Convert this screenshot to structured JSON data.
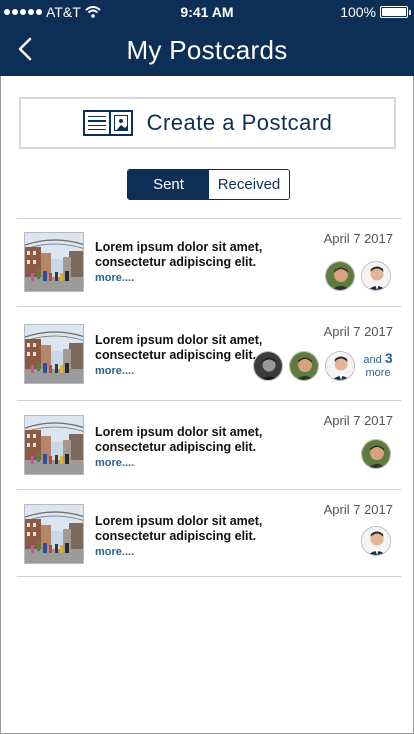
{
  "status_bar": {
    "carrier": "AT&T",
    "time": "9:41 AM",
    "battery": "100%"
  },
  "header": {
    "title": "My Postcards"
  },
  "create_button": {
    "label": "Create a Postcard"
  },
  "segmented": {
    "sent_label": "Sent",
    "received_label": "Received",
    "selected": "Sent"
  },
  "postcards": [
    {
      "text": "Lorem ipsum dolor sit amet, consectetur adipiscing elit.",
      "more": "more....",
      "date": "April 7 2017"
    },
    {
      "text": "Lorem ipsum dolor sit amet, consectetur adipiscing elit.",
      "more": "more....",
      "date": "April 7 2017",
      "and_label": "and",
      "extra_count": "3",
      "more_label": "more"
    },
    {
      "text": "Lorem ipsum dolor sit amet, consectetur adipiscing elit.",
      "more": "more....",
      "date": "April 7 2017"
    },
    {
      "text": "Lorem ipsum dolor sit amet, consectetur adipiscing elit.",
      "more": "more....",
      "date": "April 7 2017"
    }
  ],
  "colors": {
    "primary": "#0d2f56",
    "link": "#2f5f8f",
    "divider": "#cfcfcf"
  },
  "icons": [
    "signal-dots-icon",
    "wifi-icon",
    "battery-icon",
    "back-chevron-icon",
    "postcard-icon"
  ]
}
